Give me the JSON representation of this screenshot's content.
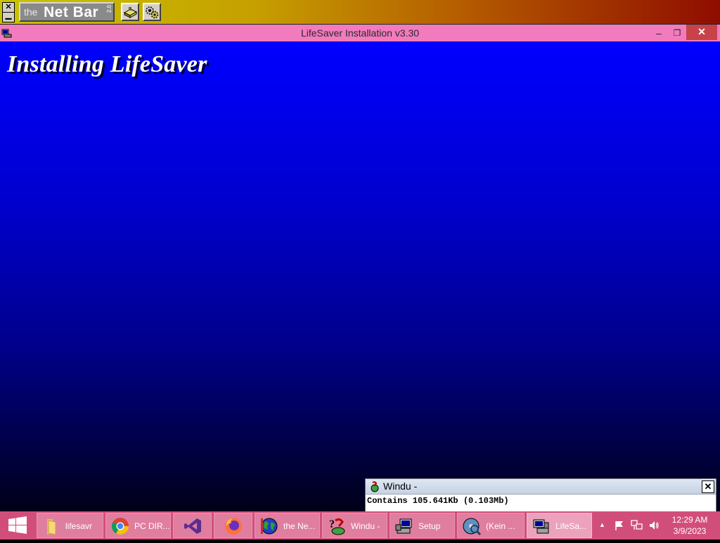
{
  "netbar": {
    "close": "✕",
    "minimize": "▁",
    "logo_the": "the",
    "logo_name": "Net Bar",
    "logo_version": "2.0",
    "buttons": [
      {
        "icon": "disk-drive-icon"
      },
      {
        "icon": "gears-icon"
      }
    ]
  },
  "window": {
    "title": "LifeSaver Installation v3.30",
    "minimize": "–",
    "maximize": "❐",
    "close": "✕"
  },
  "installer": {
    "heading": "Installing LifeSaver"
  },
  "windu": {
    "caption": "Windu -",
    "close": "✕",
    "message": "Contains 105.641Kb (0.103Mb)"
  },
  "taskbar": {
    "items": [
      {
        "label": "lifesavr",
        "icon": "folder-icon"
      },
      {
        "label": "PC DIR...",
        "icon": "chrome-icon"
      },
      {
        "label": "",
        "icon": "visual-studio-icon"
      },
      {
        "label": "",
        "icon": "firefox-icon"
      },
      {
        "label": "the Ne...",
        "icon": "globe-icon"
      },
      {
        "label": "Windu -",
        "icon": "help-icon"
      },
      {
        "label": "Setup",
        "icon": "setup-computer-icon"
      },
      {
        "label": "(Kein ...",
        "icon": "cd-search-icon"
      },
      {
        "label": "LifeSa...",
        "icon": "installer-icon",
        "active": true
      }
    ],
    "tray": {
      "up_arrow": "▲",
      "clock_time": "12:29 AM",
      "clock_date": "3/9/2023"
    }
  }
}
